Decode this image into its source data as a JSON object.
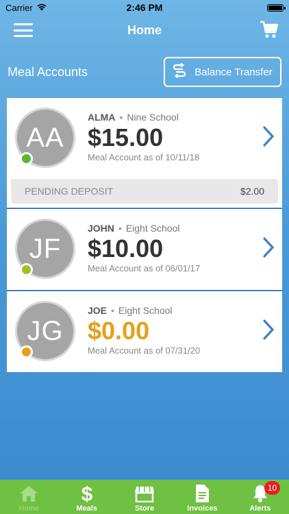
{
  "status_bar": {
    "carrier": "Carrier",
    "time": "2:46 PM"
  },
  "nav": {
    "title": "Home",
    "menu_icon": "hamburger-menu-icon",
    "cart_icon": "shopping-cart-icon"
  },
  "section": {
    "title": "Meal Accounts",
    "transfer_label": "Balance Transfer",
    "transfer_icon": "transfer-arrows-icon"
  },
  "accounts": [
    {
      "initials": "AA",
      "name": "ALMA",
      "school": "Nine School",
      "balance": "$15.00",
      "as_of": "Meal Account as of 10/11/18",
      "status_color": "#5bb534",
      "balance_color": "#333333",
      "pending": {
        "label": "PENDING DEPOSIT",
        "amount": "$2.00"
      }
    },
    {
      "initials": "JF",
      "name": "JOHN",
      "school": "Eight School",
      "balance": "$10.00",
      "as_of": "Meal Account as of 06/01/17",
      "status_color": "#9cc420",
      "balance_color": "#333333"
    },
    {
      "initials": "JG",
      "name": "JOE",
      "school": "Eight School",
      "balance": "$0.00",
      "as_of": "Meal Account as of 07/31/20",
      "status_color": "#e3a21a",
      "balance_color": "#e3a21a"
    }
  ],
  "tabs": [
    {
      "label": "Home",
      "icon": "home-icon",
      "active": true
    },
    {
      "label": "Meals",
      "icon": "dollar-icon"
    },
    {
      "label": "Store",
      "icon": "store-icon"
    },
    {
      "label": "Invoices",
      "icon": "document-icon"
    },
    {
      "label": "Alerts",
      "icon": "bell-icon",
      "badge": "10"
    }
  ],
  "colors": {
    "accent_blue": "#3d7fbf",
    "tab_green": "#6fc043",
    "badge_red": "#e52020"
  }
}
